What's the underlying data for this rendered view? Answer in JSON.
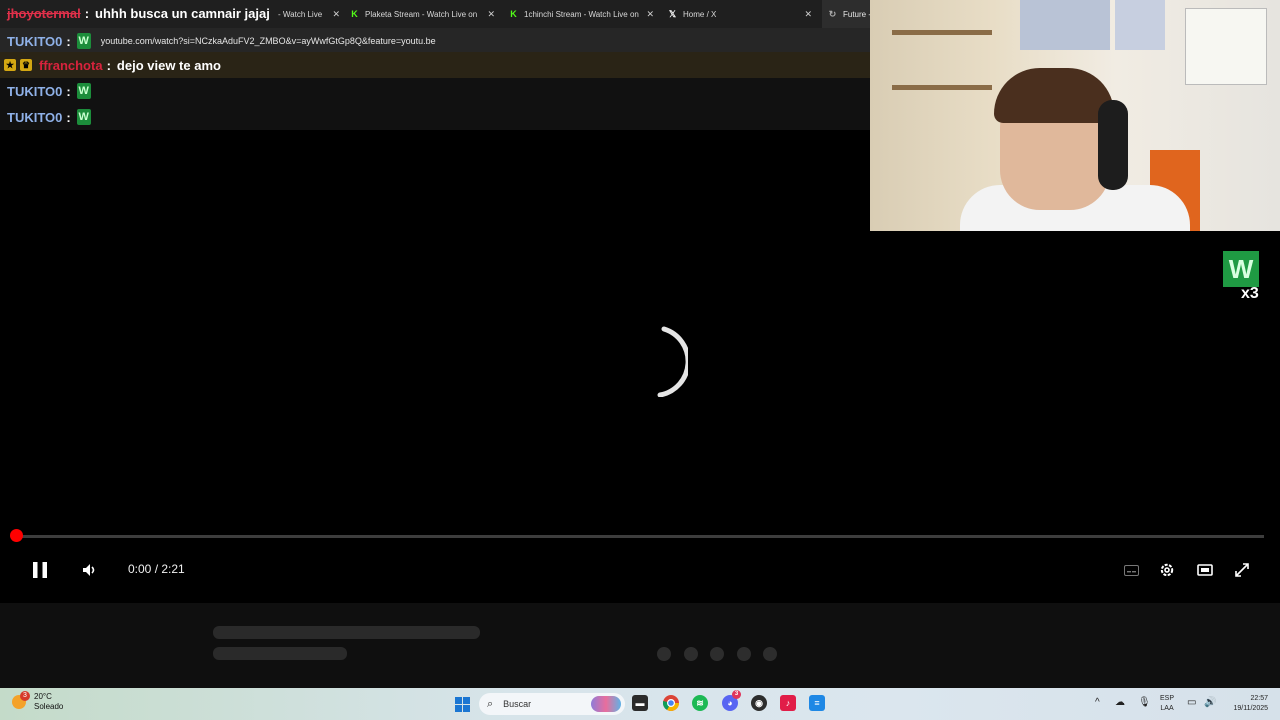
{
  "browser": {
    "tabs": [
      {
        "label": "- Watch Live",
        "favicon": "kick-logo"
      },
      {
        "label": "Plaketa Stream - Watch Live on",
        "favicon": "kick-logo"
      },
      {
        "label": "1chinchi Stream - Watch Live on",
        "favicon": "kick-logo"
      },
      {
        "label": "Home / X",
        "favicon": "x-logo"
      },
      {
        "label": "Future -",
        "favicon": "loading-icon"
      }
    ]
  },
  "chat": {
    "messages": [
      {
        "user": "jhoyotermal",
        "text": "uhhh busca un camnair jajaj"
      },
      {
        "user": "TUKITO0",
        "text": "youtube.com/watch?si=NCzkaAduFV2_ZMBO&v=ayWwfGtGp8Q&feature=youtu.be"
      },
      {
        "user": "ffranchota",
        "text": "dejo view te amo"
      },
      {
        "user": "TUKITO0",
        "text": ""
      },
      {
        "user": "TUKITO0",
        "text": ""
      }
    ],
    "emote_multiplier": "x3"
  },
  "player": {
    "time": "0:00 / 2:21",
    "progress": 0.0,
    "state": "buffering"
  },
  "taskbar": {
    "weather_temp": "20°C",
    "weather_desc": "Soleado",
    "weather_badge": "3",
    "search_placeholder": "Buscar",
    "lang_top": "ESP",
    "lang_bottom": "LAA",
    "time": "22:57",
    "date": "19/11/2025",
    "discord_badge": "3"
  },
  "colors": {
    "accent": "#ff0000",
    "kick": "#53fc18"
  }
}
